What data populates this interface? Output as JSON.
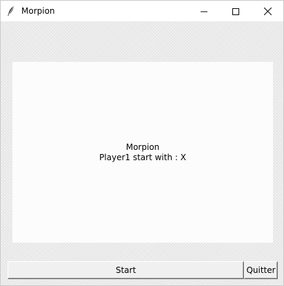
{
  "window": {
    "title": "Morpion",
    "app_icon": "feather-icon"
  },
  "window_controls": [
    "minimize-icon",
    "maximize-icon",
    "close-icon"
  ],
  "canvas": {
    "line1": "Morpion",
    "line2": "Player1 start with : X"
  },
  "buttons": {
    "start_label": "Start",
    "quit_label": "Quitter"
  },
  "colors": {
    "window_bg": "#f0f0f0",
    "canvas_bg": "#fcfcfc",
    "titlebar_bg": "#ffffff"
  }
}
